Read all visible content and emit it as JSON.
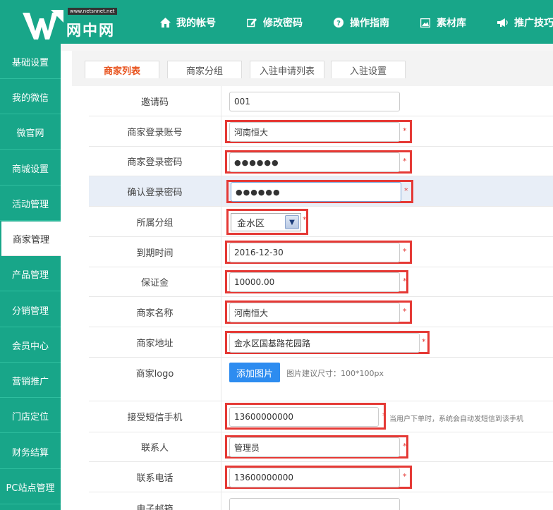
{
  "logo": {
    "text": "网中网",
    "url_badge": "www.netsnnet.net"
  },
  "nav": [
    {
      "label": "我的帐号",
      "icon": "home-icon"
    },
    {
      "label": "修改密码",
      "icon": "edit-icon"
    },
    {
      "label": "操作指南",
      "icon": "help-icon"
    },
    {
      "label": "素材库",
      "icon": "image-icon"
    },
    {
      "label": "推广技巧",
      "icon": "megaphone-icon"
    }
  ],
  "sidebar": {
    "items": [
      {
        "label": "基础设置"
      },
      {
        "label": "我的微信"
      },
      {
        "label": "微官网"
      },
      {
        "label": "商城设置"
      },
      {
        "label": "活动管理"
      },
      {
        "label": "商家管理",
        "active": true
      },
      {
        "label": "产品管理"
      },
      {
        "label": "分销管理"
      },
      {
        "label": "会员中心"
      },
      {
        "label": "营销推广"
      },
      {
        "label": "门店定位"
      },
      {
        "label": "财务结算"
      },
      {
        "label": "PC站点管理"
      }
    ]
  },
  "tabs": [
    {
      "label": "商家列表",
      "active": true
    },
    {
      "label": "商家分组"
    },
    {
      "label": "入驻申请列表"
    },
    {
      "label": "入驻设置"
    }
  ],
  "form": {
    "invite_code": {
      "label": "邀请码",
      "value": "001"
    },
    "login_account": {
      "label": "商家登录账号",
      "value": "河南恒大"
    },
    "login_password": {
      "label": "商家登录密码",
      "value": "●●●●●●"
    },
    "confirm_password": {
      "label": "确认登录密码",
      "value": "●●●●●●"
    },
    "group": {
      "label": "所属分组",
      "value": "金水区"
    },
    "expire_time": {
      "label": "到期时间",
      "value": "2016-12-30"
    },
    "deposit": {
      "label": "保证金",
      "value": "10000.00"
    },
    "merchant_name": {
      "label": "商家名称",
      "value": "河南恒大"
    },
    "merchant_address": {
      "label": "商家地址",
      "value": "金水区国基路花园路"
    },
    "merchant_logo": {
      "label": "商家logo",
      "button": "添加图片",
      "hint": "图片建议尺寸：100*100px"
    },
    "sms_phone": {
      "label": "接受短信手机",
      "value": "13600000000",
      "hint": "当用户下单时，系统会自动发短信到该手机"
    },
    "contact_person": {
      "label": "联系人",
      "value": "管理员"
    },
    "contact_phone": {
      "label": "联系电话",
      "value": "13600000000"
    },
    "email": {
      "label": "电子邮箱",
      "value": ""
    }
  },
  "required_mark": "*",
  "colors": {
    "brand": "#18a689",
    "highlight": "#e53935",
    "tab_active": "#e8541f",
    "button": "#2d8cf0"
  }
}
